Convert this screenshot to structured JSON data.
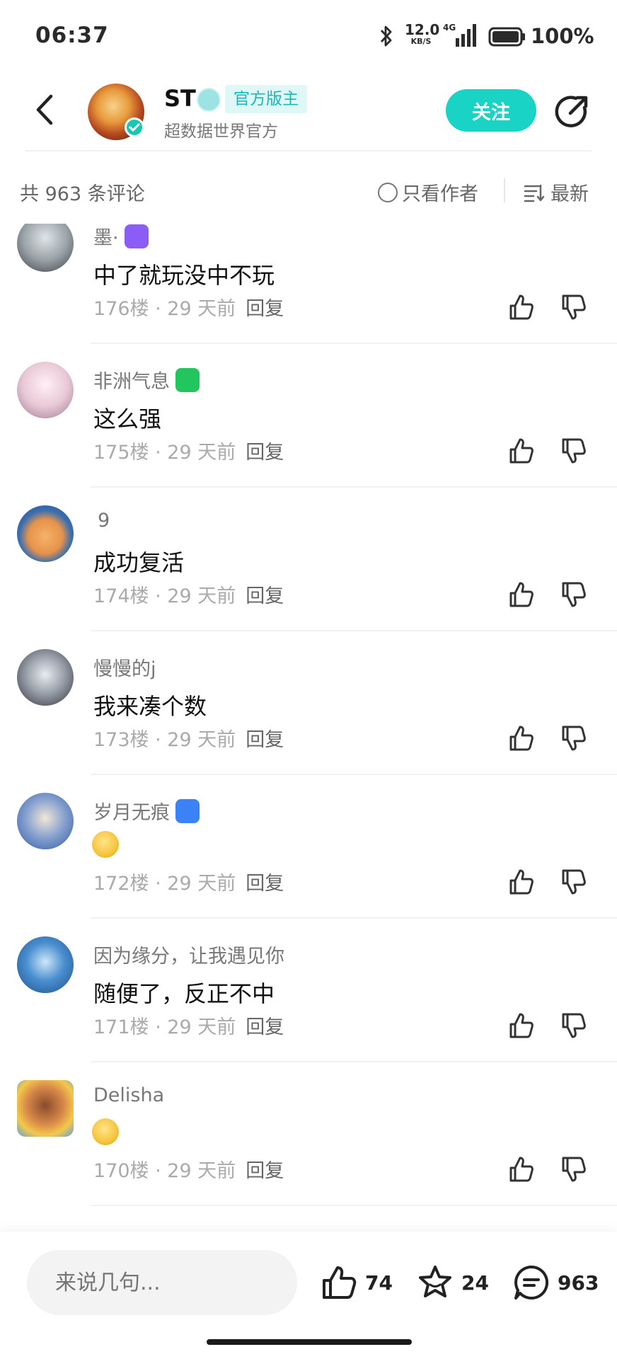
{
  "status_bar": {
    "time": "06:37",
    "net_speed_value": "12.0",
    "net_speed_unit": "KB/S",
    "network": "4G",
    "battery": "100%"
  },
  "header": {
    "name": "ST",
    "tag": "官方版主",
    "subtitle": "超数据世界官方",
    "follow_label": "关注"
  },
  "filter": {
    "count_text": "共 963 条评论",
    "author_only_label": "只看作者",
    "sort_label": "最新"
  },
  "comments": [
    {
      "username": "墨·",
      "badge_color": "#8b5cf6",
      "text": "中了就玩没中不玩",
      "floor": "176楼",
      "time": "29 天前",
      "reply_label": "回复",
      "avatar_color": "#9aa3a8"
    },
    {
      "username": "非洲气息",
      "badge_color": "#22c55e",
      "text": "这么强",
      "floor": "175楼",
      "time": "29 天前",
      "reply_label": "回复",
      "avatar_color": "#e9c9d6"
    },
    {
      "username": "9",
      "badge_color": "",
      "text": "成功复活",
      "floor": "174楼",
      "time": "29 天前",
      "reply_label": "回复",
      "avatar_color": "#3b6fb0"
    },
    {
      "username": "慢慢的j",
      "badge_color": "",
      "text": "我来凑个数",
      "floor": "173楼",
      "time": "29 天前",
      "reply_label": "回复",
      "avatar_color": "#6b6f78"
    },
    {
      "username": "岁月无痕",
      "badge_color": "#3b82f6",
      "text": "",
      "emoji": "smile-emoji",
      "floor": "172楼",
      "time": "29 天前",
      "reply_label": "回复",
      "avatar_color": "#2c5aa8"
    },
    {
      "username": "因为缘分，让我遇见你",
      "badge_color": "",
      "text": "随便了，反正不中",
      "floor": "171楼",
      "time": "29 天前",
      "reply_label": "回复",
      "avatar_color": "#1d6fb8"
    },
    {
      "username": "Delisha",
      "badge_color": "",
      "text": "",
      "emoji": "smile-emoji",
      "floor": "170楼",
      "time": "29 天前",
      "reply_label": "回复",
      "avatar_color": "#d98a4a"
    }
  ],
  "bottom_bar": {
    "input_placeholder": "来说几句...",
    "like_count": "74",
    "star_count": "24",
    "comment_count": "963"
  },
  "colors": {
    "accent": "#19d3c5",
    "text_primary": "#111111",
    "text_secondary": "#777777"
  }
}
